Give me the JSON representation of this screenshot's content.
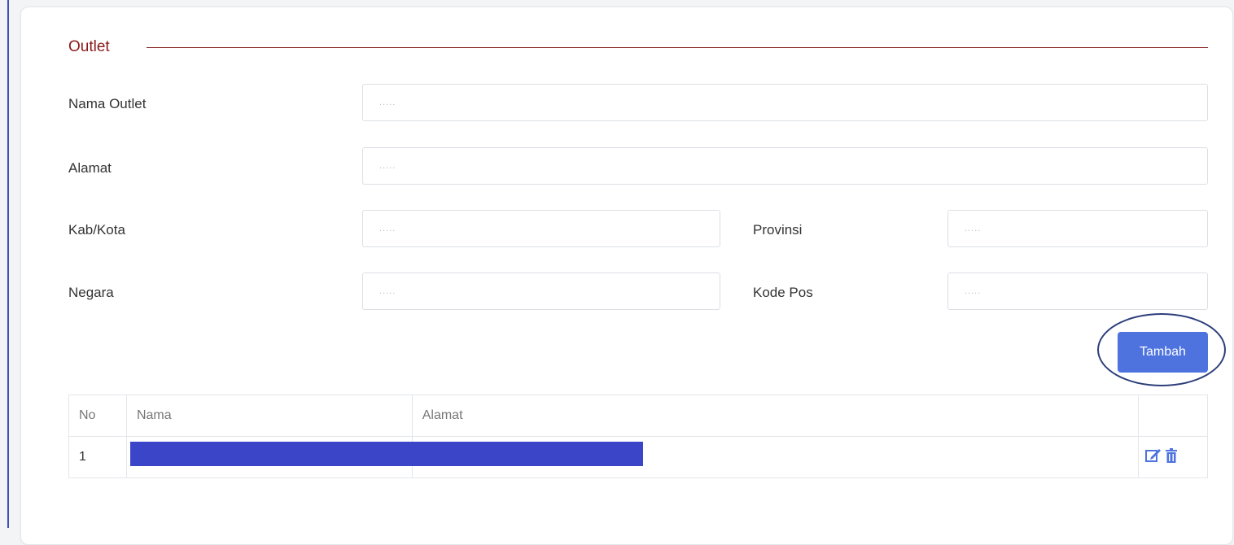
{
  "section": {
    "title": "Outlet"
  },
  "form": {
    "nama_outlet": {
      "label": "Nama Outlet",
      "placeholder": "....."
    },
    "alamat": {
      "label": "Alamat",
      "placeholder": "....."
    },
    "kab_kota": {
      "label": "Kab/Kota",
      "placeholder": "....."
    },
    "provinsi": {
      "label": "Provinsi",
      "placeholder": "....."
    },
    "negara": {
      "label": "Negara",
      "placeholder": "....."
    },
    "kode_pos": {
      "label": "Kode Pos",
      "placeholder": "....."
    },
    "add_button": "Tambah"
  },
  "table": {
    "headers": [
      "No",
      "Nama",
      "Alamat",
      ""
    ],
    "rows": [
      {
        "no": "1"
      }
    ]
  },
  "icons": {
    "edit": "edit-icon",
    "delete": "trash-icon"
  },
  "colors": {
    "accent": "#4e73df",
    "section_title": "#8b1a1a",
    "redaction": "#3a45c8",
    "action_icon": "#4e73df"
  }
}
